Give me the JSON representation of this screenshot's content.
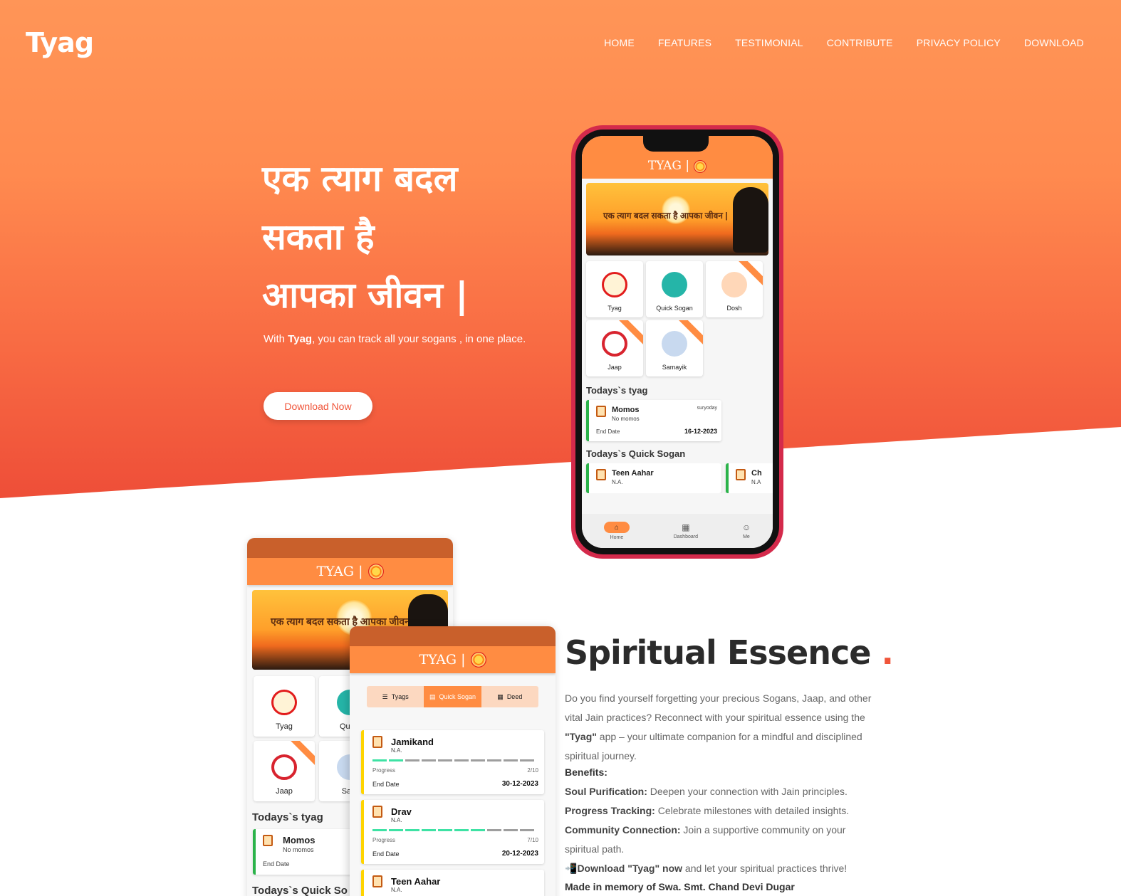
{
  "brand": "Tyag",
  "nav": [
    "HOME",
    "FEATURES",
    "TESTIMONIAL",
    "CONTRIBUTE",
    "PRIVACY POLICY",
    "DOWNLOAD"
  ],
  "hero": {
    "title_line1": "एक त्याग बदल",
    "title_line2": "सकता है",
    "title_line3": "आपका जीवन |",
    "sub_pre": "With ",
    "sub_bold": "Tyag",
    "sub_post": ", you can track all your sogans , in one place.",
    "cta": "Download Now"
  },
  "app": {
    "logo_text": "TYAG |",
    "banner_text": "एक त्याग बदल सकता है आपका जीवन |",
    "tiles": [
      "Tyag",
      "Quick Sogan",
      "Dosh",
      "Jaap",
      "Samayik"
    ],
    "todays_tyag_heading": "Todays`s tyag",
    "todays_quick_heading": "Todays`s Quick Sogan",
    "tyag_card": {
      "title": "Momos",
      "sub": "No momos",
      "tag": "suryoday",
      "end_label": "End Date",
      "end_value": "16-12-2023"
    },
    "quick_cards": [
      {
        "title": "Teen Aahar",
        "sub": "N.A."
      },
      {
        "title": "Ch",
        "sub": "N.A"
      }
    ],
    "bottom_nav": [
      "Home",
      "Dashboard",
      "Me"
    ]
  },
  "mock1": {
    "tiles": [
      "Tyag",
      "Quick",
      "Jaap",
      "Sam"
    ],
    "heading": "Todays`s tyag",
    "card_title": "Momos",
    "card_sub": "No momos",
    "card_end": "End Date",
    "heading2": "Todays`s Quick So"
  },
  "mock2": {
    "tabs": [
      "Tyags",
      "Quick Sogan",
      "Deed"
    ],
    "cards": [
      {
        "title": "Jamikand",
        "sub": "N.A.",
        "progress_label": "Progress",
        "progress": "2/10",
        "end_label": "End Date",
        "end": "30-12-2023"
      },
      {
        "title": "Drav",
        "sub": "N.A.",
        "progress_label": "Progress",
        "progress": "7/10",
        "end_label": "End Date",
        "end": "20-12-2023"
      },
      {
        "title": "Teen Aahar",
        "sub": "N.A."
      }
    ]
  },
  "section": {
    "title": "Spiritual Essence",
    "dot": ".",
    "body_pre": "Do you find yourself forgetting your precious Sogans, Jaap, and other vital Jain practices? Reconnect with your spiritual essence using the ",
    "body_bold": "\"Tyag\"",
    "body_post": " app – your ultimate companion for a mindful and disciplined spiritual journey.",
    "benefits_heading": "Benefits:",
    "benefits": [
      {
        "label": "Soul Purification:",
        "text": " Deepen your connection with Jain principles."
      },
      {
        "label": "Progress Tracking:",
        "text": " Celebrate milestones with detailed insights."
      },
      {
        "label": "Community Connection:",
        "text": " Join a supportive community on your spiritual path."
      }
    ],
    "download_icon": "📲",
    "download_bold": "Download \"Tyag\" now",
    "download_text": " and let your spiritual practices thrive!",
    "memory": "Made in memory of Swa. Smt. Chand Devi Dugar"
  },
  "colors": {
    "accent": "#ff8c42",
    "red": "#f0553a",
    "phone_frame": "#d42a4b"
  }
}
